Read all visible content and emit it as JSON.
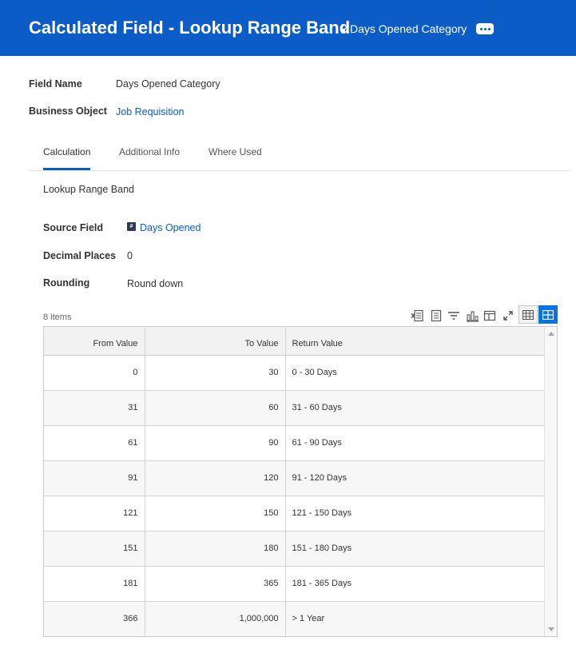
{
  "header": {
    "title": "Calculated Field - Lookup Range Band",
    "object_name": "Days Opened Category",
    "object_icon": "related-actions-icon",
    "more_icon": "ellipsis-icon",
    "color": "#0b5cc7"
  },
  "fields": {
    "field_name_label": "Field Name",
    "field_name_value": "Days Opened Category",
    "business_object_label": "Business Object",
    "business_object_value": "Job Requisition"
  },
  "tabs": [
    {
      "label": "Calculation",
      "active": true
    },
    {
      "label": "Additional Info",
      "active": false
    },
    {
      "label": "Where Used",
      "active": false
    }
  ],
  "calculation": {
    "function_name": "Lookup Range Band",
    "source_field_label": "Source Field",
    "source_field_value": "Days Opened",
    "source_field_badge": "#",
    "decimal_places_label": "Decimal Places",
    "decimal_places_value": "0",
    "rounding_label": "Rounding",
    "rounding_value": "Round down"
  },
  "grid": {
    "items_count": "8 items",
    "toolbar_icons": [
      "excel-export-icon",
      "pdf-export-icon",
      "filter-icon",
      "chart-icon",
      "column-layout-icon",
      "fullscreen-icon",
      "table-view-icon",
      "grid-view-icon"
    ],
    "columns": [
      "From Value",
      "To Value",
      "Return Value"
    ],
    "rows": [
      {
        "from": "0",
        "to": "30",
        "ret": "0 - 30 Days"
      },
      {
        "from": "31",
        "to": "60",
        "ret": "31 - 60 Days"
      },
      {
        "from": "61",
        "to": "90",
        "ret": "61 - 90 Days"
      },
      {
        "from": "91",
        "to": "120",
        "ret": "91 - 120 Days"
      },
      {
        "from": "121",
        "to": "150",
        "ret": "121 - 150 Days"
      },
      {
        "from": "151",
        "to": "180",
        "ret": "151 - 180 Days"
      },
      {
        "from": "181",
        "to": "365",
        "ret": "181 - 365 Days"
      },
      {
        "from": "366",
        "to": "1,000,000",
        "ret": "> 1 Year"
      }
    ]
  }
}
